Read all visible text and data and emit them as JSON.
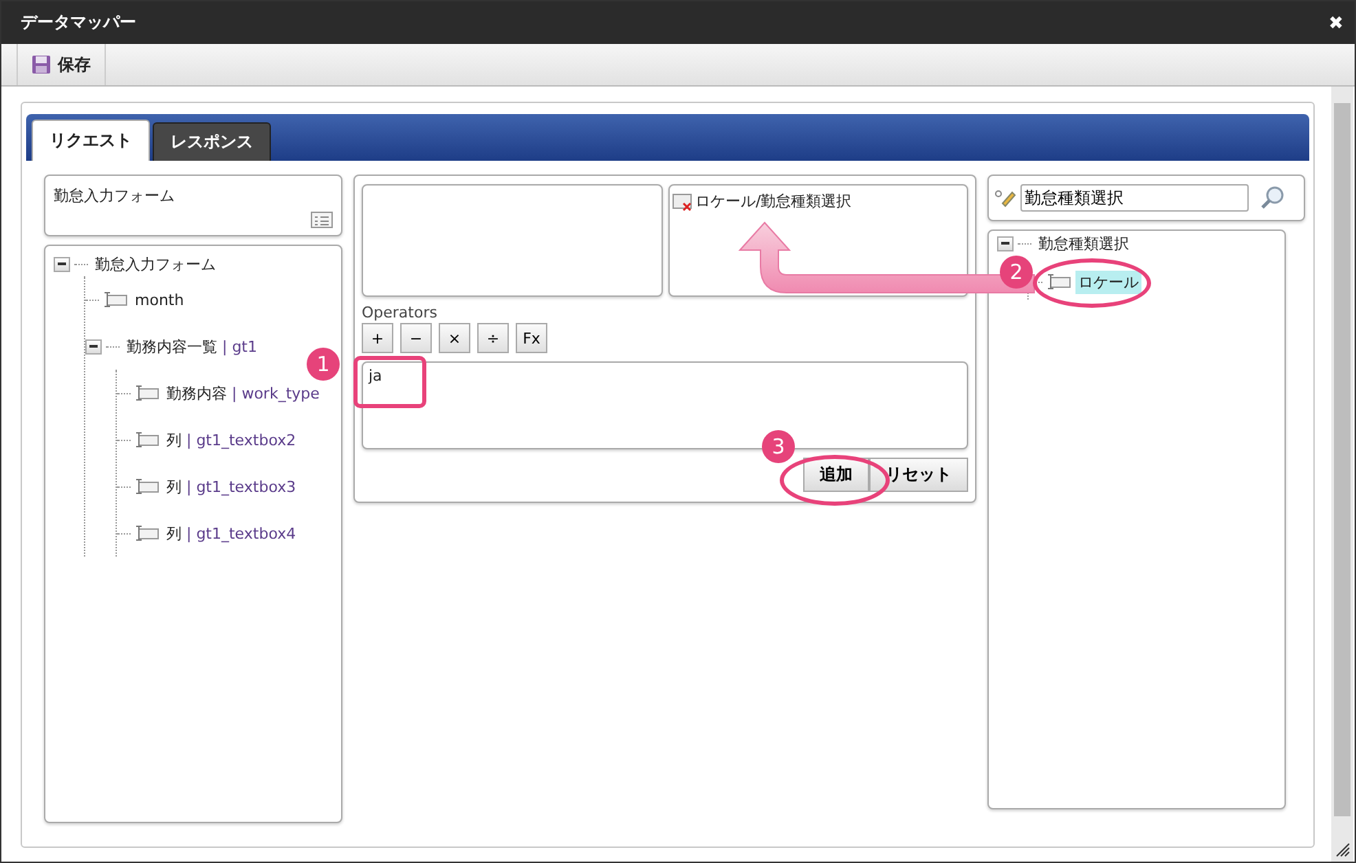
{
  "window": {
    "title": "データマッパー",
    "close": "✖"
  },
  "toolbar": [
    {
      "label": "保存"
    }
  ],
  "tabs": [
    {
      "label": "リクエスト",
      "selected": true
    },
    {
      "label": "レスポンス",
      "selected": false
    }
  ],
  "form": {
    "title": "勤怠入力フォーム"
  },
  "left_tree": [
    {
      "name": "勤怠入力フォーム",
      "expanded": true,
      "selected": false,
      "children": [
        {
          "name": "month",
          "selected": false
        },
        {
          "name": "勤務内容一覧",
          "code": "| gt1",
          "expanded": true,
          "selected": false,
          "children": [
            {
              "name": "勤務内容",
              "code": "| work_type",
              "selected": false
            },
            {
              "name": "列",
              "code": "| gt1_textbox2",
              "selected": false
            },
            {
              "name": "列",
              "code": "| gt1_textbox3",
              "selected": false
            },
            {
              "name": "列",
              "code": "| gt1_textbox4",
              "selected": false
            }
          ]
        }
      ]
    }
  ],
  "mapping": {
    "target": "ロケール/勤怠種類選択",
    "operators_label": "Operators",
    "operators": [
      "+",
      "−",
      "×",
      "÷",
      "Fx"
    ],
    "expression": "ja",
    "buttons": [
      "追加",
      "リセット"
    ]
  },
  "search": {
    "value": "勤怠種類選択"
  },
  "right_tree": [
    {
      "name": "勤怠種類選択",
      "expanded": true,
      "selected": false,
      "children": [
        {
          "name": "ロケール",
          "selected": true
        }
      ]
    }
  ],
  "callouts": [
    {
      "label": "1"
    },
    {
      "label": "2"
    },
    {
      "label": "3"
    }
  ]
}
